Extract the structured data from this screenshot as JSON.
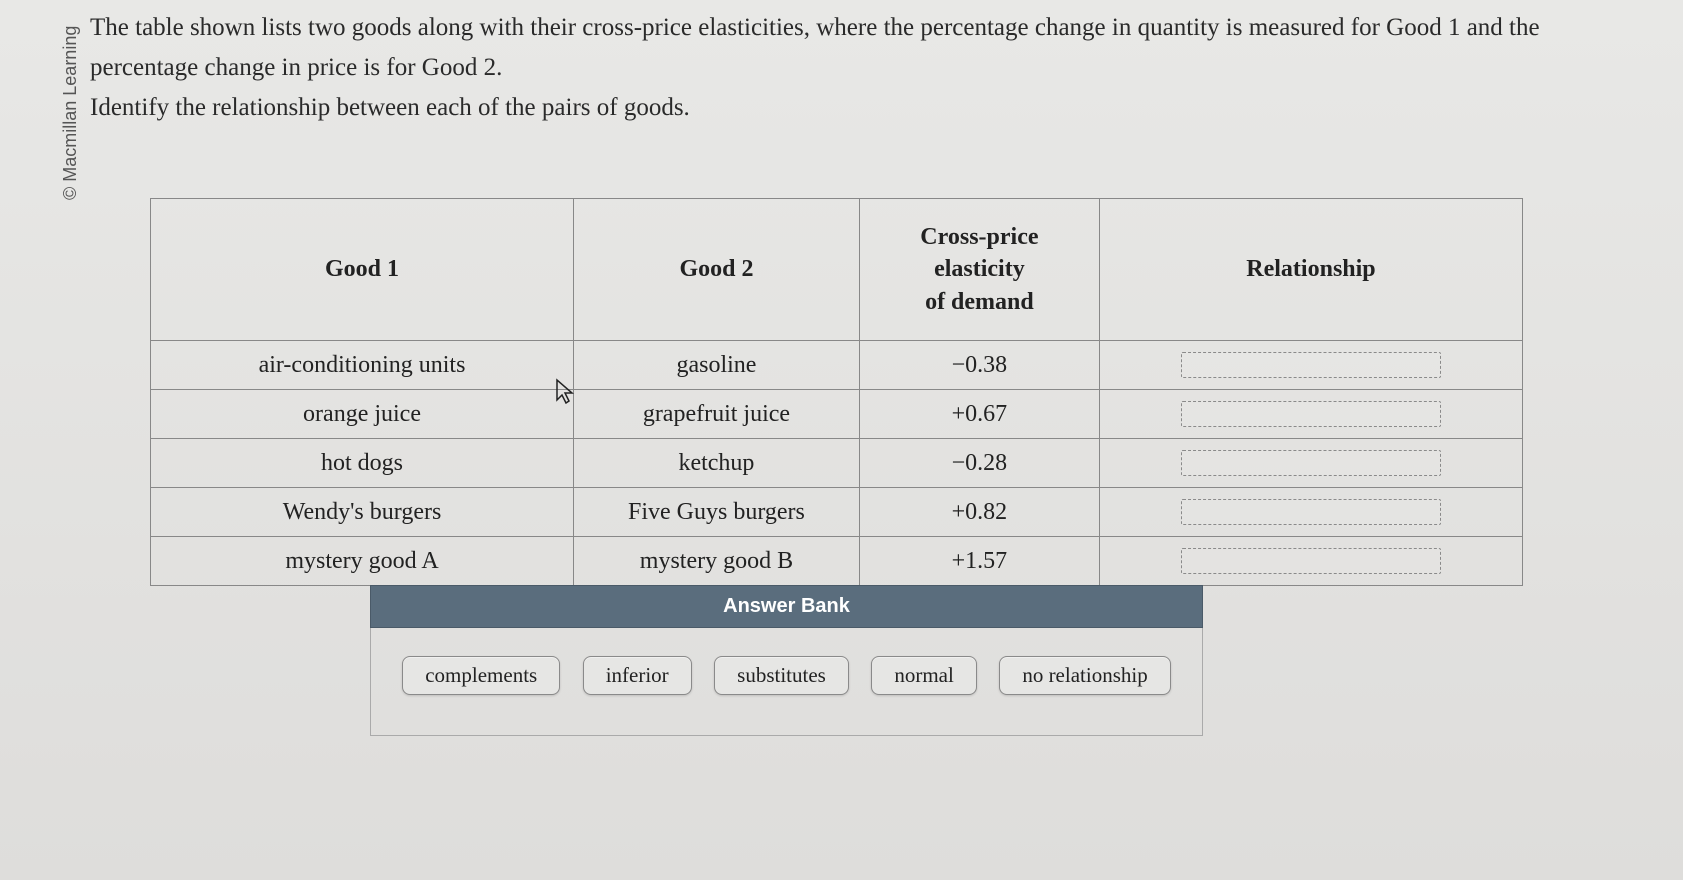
{
  "watermark": "© Macmillan Learning",
  "prompt_line1": "The table shown lists two goods along with their cross-price elasticities, where the percentage change in quantity is measured for Good 1 and the percentage change in price is for Good 2.",
  "prompt_line2": "Identify the relationship between each of the pairs of goods.",
  "table": {
    "headers": {
      "good1": "Good 1",
      "good2": "Good 2",
      "cpe_line1": "Cross-price",
      "cpe_line2": "elasticity",
      "cpe_line3": "of demand",
      "rel": "Relationship"
    },
    "rows": [
      {
        "good1": "air-conditioning units",
        "good2": "gasoline",
        "cpe": "−0.38"
      },
      {
        "good1": "orange juice",
        "good2": "grapefruit juice",
        "cpe": "+0.67"
      },
      {
        "good1": "hot dogs",
        "good2": "ketchup",
        "cpe": "−0.28"
      },
      {
        "good1": "Wendy's burgers",
        "good2": "Five Guys burgers",
        "cpe": "+0.82"
      },
      {
        "good1": "mystery good A",
        "good2": "mystery good B",
        "cpe": "+1.57"
      }
    ]
  },
  "answer_bank": {
    "title": "Answer Bank",
    "options": [
      "complements",
      "inferior",
      "substitutes",
      "normal",
      "no relationship"
    ]
  }
}
